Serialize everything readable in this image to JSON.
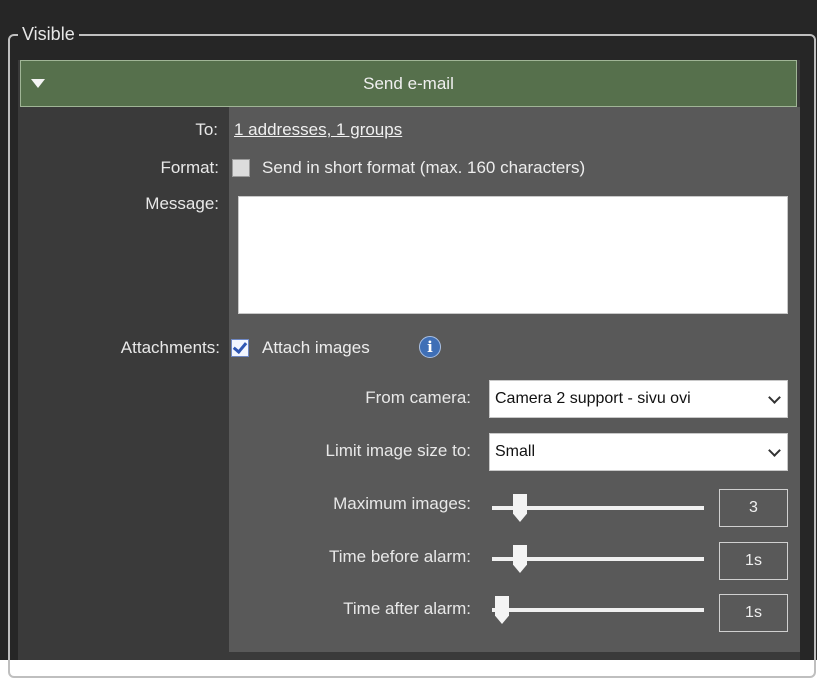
{
  "group": {
    "legend": "Visible"
  },
  "header": {
    "title": "Send e-mail"
  },
  "to": {
    "label": "To:",
    "value": "1 addresses, 1 groups"
  },
  "format": {
    "label": "Format:",
    "checkbox_label": "Send in short format (max. 160 characters)",
    "checked": false
  },
  "message": {
    "label": "Message:",
    "value": ""
  },
  "attachments": {
    "label": "Attachments:",
    "checkbox_label": "Attach images",
    "checked": true,
    "info_icon": "i"
  },
  "from_camera": {
    "label": "From camera:",
    "value": "Camera 2 support - sivu ovi"
  },
  "limit_size": {
    "label": "Limit image size to:",
    "value": "Small"
  },
  "max_images": {
    "label": "Maximum images:",
    "value": "3"
  },
  "time_before": {
    "label": "Time before alarm:",
    "value": "1s"
  },
  "time_after": {
    "label": "Time after alarm:",
    "value": "1s"
  }
}
